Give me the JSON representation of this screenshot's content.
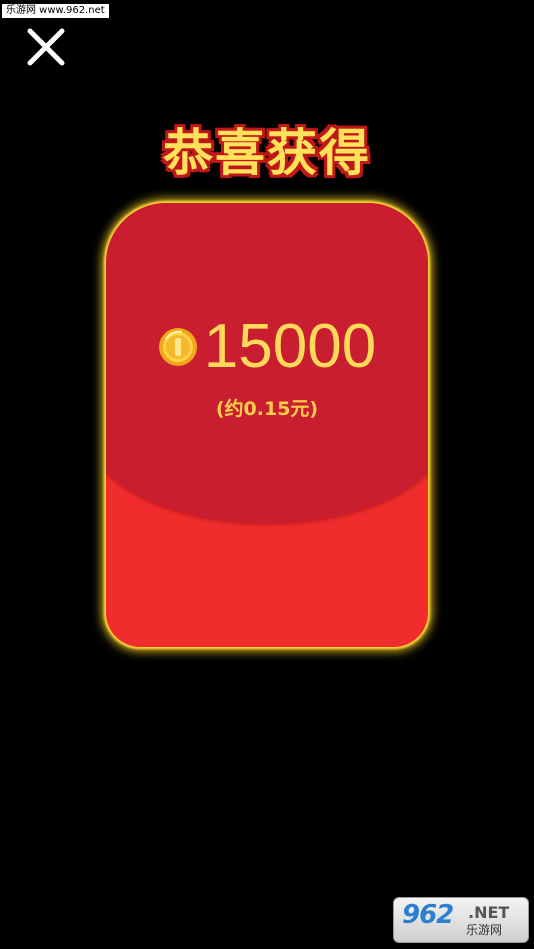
{
  "watermark_top": "乐游网 www.962.net",
  "close_icon": "close-icon",
  "title": "恭喜获得",
  "reward": {
    "coin_icon": "coin-icon",
    "amount": "15000",
    "approx": "(约0.15元)"
  },
  "watermark_bottom": {
    "logo_num": "962",
    "logo_net": ".NET",
    "logo_cn": "乐游网"
  },
  "colors": {
    "background": "#000000",
    "envelope_body": "#f02c2c",
    "envelope_flap": "#c91e30",
    "gold_text": "#ffd95a",
    "glow": "#ffe04a"
  }
}
